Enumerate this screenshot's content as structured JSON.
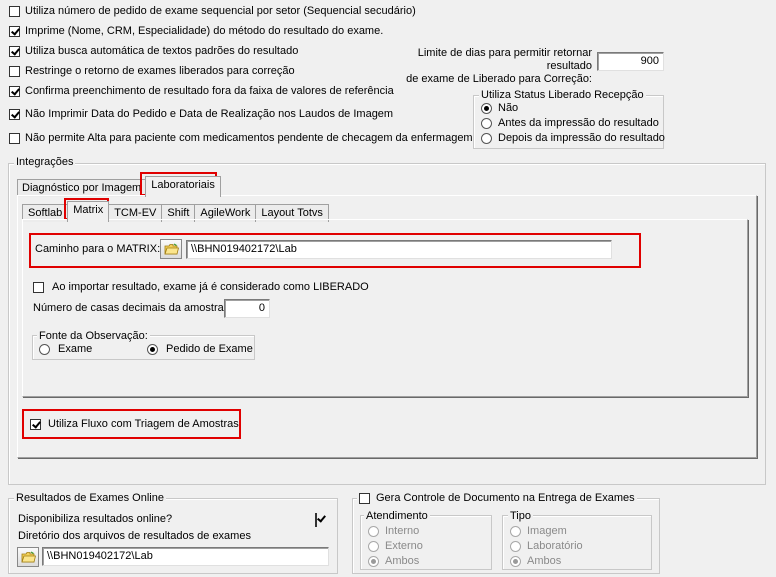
{
  "options": {
    "sequential_per_sector": {
      "label": "Utiliza número de pedido de exame sequencial por setor (Sequencial secudário)",
      "checked": false
    },
    "print_name_crm": {
      "label": "Imprime (Nome, CRM, Especialidade) do método do resultado do exame.",
      "checked": true
    },
    "auto_text_search": {
      "label": "Utiliza busca automática de textos padrões do resultado",
      "checked": true
    },
    "restrict_return": {
      "label": "Restringe o retorno de exames liberados para correção",
      "checked": false
    },
    "confirm_out_of_range": {
      "label": "Confirma preenchimento de resultado fora da faixa de valores de referência",
      "checked": true
    },
    "no_print_dates": {
      "label": "Não Imprimir Data do Pedido e Data de Realização nos Laudos de Imagem",
      "checked": true
    },
    "no_discharge_pending": {
      "label": "Não permite Alta para paciente com medicamentos pendente de checagem da enfermagem",
      "checked": false
    }
  },
  "days_limit": {
    "label_line1": "Limite de dias para permitir retornar resultado",
    "label_line2": "de exame de Liberado para Correção:",
    "value": "900"
  },
  "status_group": {
    "legend": "Utiliza Status Liberado Recepção",
    "options": [
      "Não",
      "Antes da impressão do resultado",
      "Depois da impressão do resultado"
    ],
    "selected": 0
  },
  "integrations": {
    "legend": "Integrações",
    "top_tabs": [
      "Diagnóstico por Imagem",
      "Laboratoriais"
    ],
    "active_top_tab": 1,
    "sub_tabs": [
      "Softlab",
      "Matrix",
      "TCM-EV",
      "Shift",
      "AgileWork",
      "Layout Totvs"
    ],
    "active_sub_tab": 1,
    "matrix_path_label": "Caminho para o MATRIX:",
    "matrix_path_value": "\\\\BHN019402172\\Lab",
    "import_released": {
      "label": "Ao importar resultado, exame já é considerado como LIBERADO",
      "checked": false
    },
    "decimal_label": "Número de casas decimais da amostra:",
    "decimal_value": "0",
    "obs_source": {
      "legend": "Fonte da Observação:",
      "options": [
        "Exame",
        "Pedido de Exame"
      ],
      "selected": 1
    },
    "triage_flow": {
      "label": "Utiliza Fluxo com Triagem de Amostras",
      "checked": true
    }
  },
  "online_results": {
    "legend": "Resultados de Exames Online",
    "available_label": "Disponibiliza resultados online?",
    "available_checked": true,
    "dir_label": "Diretório dos arquivos de resultados de exames",
    "dir_value": "\\\\BHN019402172\\Lab"
  },
  "doc_control": {
    "legend": "Gera Controle de Documento na Entrega de Exames",
    "checked": false,
    "atendimento": {
      "legend": "Atendimento",
      "options": [
        "Interno",
        "Externo",
        "Ambos"
      ],
      "selected": 2
    },
    "tipo": {
      "legend": "Tipo",
      "options": [
        "Imagem",
        "Laboratório",
        "Ambos"
      ],
      "selected": 2
    }
  },
  "colors": {
    "highlight": "#e00000",
    "background": "#f0f0f0"
  },
  "icons": [
    "folder-icon",
    "checkbox",
    "radio-button"
  ]
}
